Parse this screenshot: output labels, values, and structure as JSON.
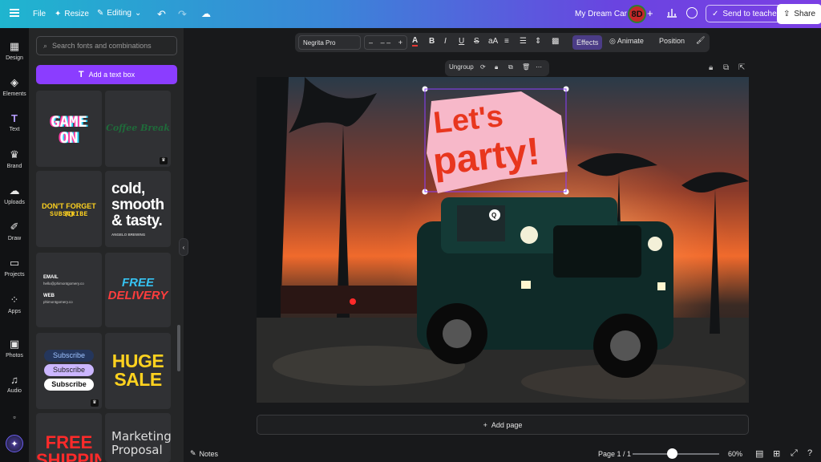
{
  "topbar": {
    "file": "File",
    "resize": "Resize",
    "editing": "Editing",
    "design_title": "My Dream Car",
    "avatar_initials": "8D",
    "send_to_teacher": "Send to teacher",
    "share": "Share"
  },
  "rail": {
    "items": [
      {
        "label": "Design",
        "icon": "layout-icon"
      },
      {
        "label": "Elements",
        "icon": "shapes-icon"
      },
      {
        "label": "Text",
        "icon": "text-icon"
      },
      {
        "label": "Brand",
        "icon": "brand-icon"
      },
      {
        "label": "Uploads",
        "icon": "cloud-upload-icon"
      },
      {
        "label": "Draw",
        "icon": "pen-icon"
      },
      {
        "label": "Projects",
        "icon": "folder-icon"
      },
      {
        "label": "Apps",
        "icon": "apps-icon"
      },
      {
        "label": "Photos",
        "icon": "image-icon"
      },
      {
        "label": "Audio",
        "icon": "music-icon"
      }
    ]
  },
  "panel": {
    "search_placeholder": "Search fonts and combinations",
    "add_text_box": "Add a text box",
    "tiles": {
      "game_on_1": "GAME",
      "game_on_2": "ON",
      "coffee_break": "Coffee Break",
      "dont_forget_1": "DON'T FORGET TO",
      "dont_forget_2": "SUBSCRIBE",
      "cold_1": "cold,",
      "cold_2": "smooth",
      "cold_3": "& tasty.",
      "cold_sub": "ANGELO BREWING",
      "email_label": "EMAIL",
      "email_value": "hello@phimontgomery.co",
      "web_label": "WEB",
      "web_value": "phimontgomery.co",
      "free_delivery_1": "FREE",
      "free_delivery_2": "DELIVERY",
      "subscribe": "Subscribe",
      "huge": "HUGE",
      "sale": "SALE",
      "free_shipping_1": "FREE",
      "free_shipping_2": "SHIPPING",
      "marketing_1": "Marketing",
      "marketing_2": "Proposal"
    }
  },
  "format_bar": {
    "font": "Negrita Pro",
    "size_minus": "–",
    "size_value": "– –",
    "size_plus": "+",
    "effects": "Effects",
    "animate": "Animate",
    "position": "Position"
  },
  "group_bar": {
    "ungroup": "Ungroup"
  },
  "canvas": {
    "headline_1": "Let's",
    "headline_2": "party!",
    "badge": "Q"
  },
  "add_page": "Add page",
  "bottom": {
    "notes": "Notes",
    "page": "Page 1 / 1",
    "zoom": "60%",
    "zoom_level": 0.42
  },
  "colors": {
    "accent": "#8b3dff",
    "topbar_start": "#1fb5cf",
    "topbar_end": "#7b3fe4",
    "headline_red": "#e8361e",
    "headline_pink": "#f7b8c9"
  }
}
